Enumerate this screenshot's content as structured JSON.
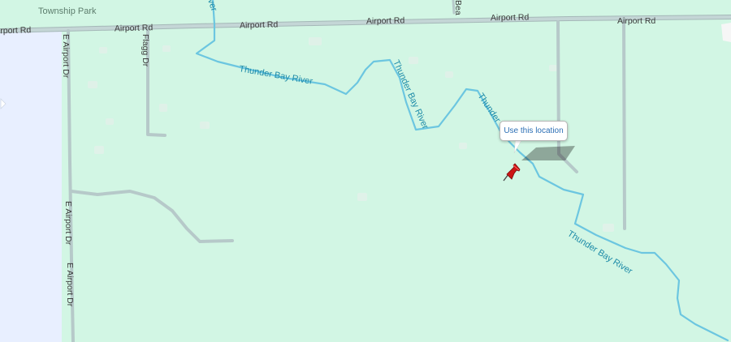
{
  "map": {
    "park_label": "Township Park",
    "road_labels": {
      "airport_rd_1": "Airport Rd",
      "airport_rd_2": "Airport Rd",
      "airport_rd_3": "Airport Rd",
      "airport_rd_4": "Airport Rd",
      "airport_rd_5": "Airport Rd",
      "flagg_dr": "Flagg Dr",
      "e_airport_dr_1": "E Airport Dr",
      "e_airport_dr_2": "E Airport Dr",
      "e_airport_dr_3": "E Airport Dr",
      "bea_partial": "Bea"
    },
    "river_labels": {
      "river_1": "Thunder Bay River",
      "river_2": "Thunder Bay River",
      "river_3": "Thunder",
      "river_4": "Thunder Bay River",
      "river_top_partial": "ver"
    },
    "colors": {
      "land": "#d2f6e4",
      "water_body": "#e8efff",
      "road": "#b6c9c9",
      "road_casing": "#a5b8b8",
      "river": "#6cc6e0",
      "river_label": "#1d8ba8",
      "pin": "#cc1515",
      "link": "#2c6fb5"
    }
  },
  "marker": {
    "icon": "red-pushpin-icon",
    "tooltip_text": "Use this location"
  }
}
